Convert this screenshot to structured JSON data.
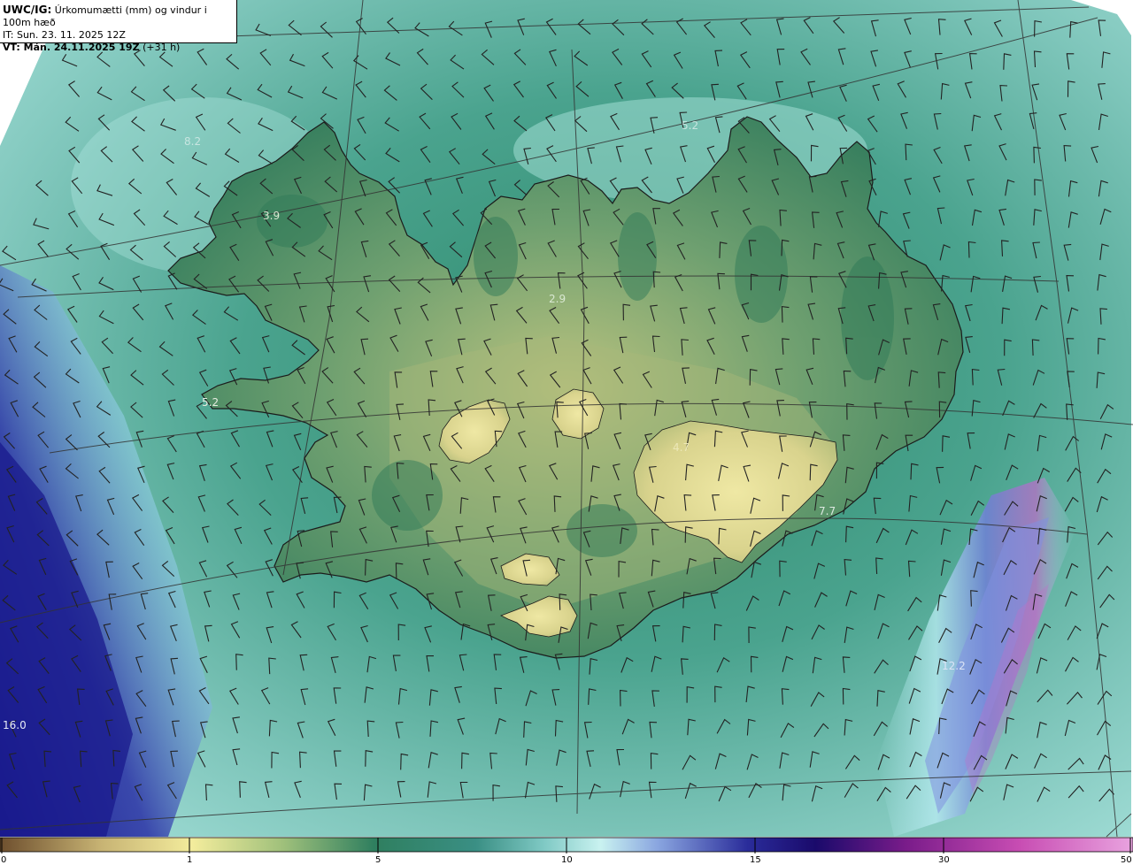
{
  "title": {
    "product": "UWC/IG:",
    "description": "Úrkomumætti (mm) og vindur i 100m hæð",
    "it_line": "IT: Sun. 23. 11. 2025 12Z",
    "vt_bold": "VT: Mán. 24.11.2025 19Z",
    "vt_rest": "(+31 h)"
  },
  "value_labels": [
    {
      "text": "8.2"
    },
    {
      "text": "3.9"
    },
    {
      "text": "2.9"
    },
    {
      "text": "5.2"
    },
    {
      "text": "4.7"
    },
    {
      "text": "7.7"
    },
    {
      "text": "12.2"
    },
    {
      "text": "16.0"
    },
    {
      "text": "5.2"
    }
  ],
  "colorbar": {
    "ticks": [
      "0",
      "1",
      "5",
      "10",
      "15",
      "30",
      "50"
    ],
    "stops": [
      "#6e4f2e",
      "#c8b474",
      "#f3ec9c",
      "#9fc07b",
      "#2f7f5f",
      "#3a8f84",
      "#7fc9c4",
      "#c9f2f0",
      "#8aa6e0",
      "#2a2c9a",
      "#1a0a6b",
      "#7a1c8a",
      "#c84db3",
      "#e9a3df"
    ]
  },
  "legend_colors": {
    "low": "#c8b474",
    "mid": "#2f7f5f",
    "high": "#2a2c9a",
    "extreme": "#c84db3"
  }
}
